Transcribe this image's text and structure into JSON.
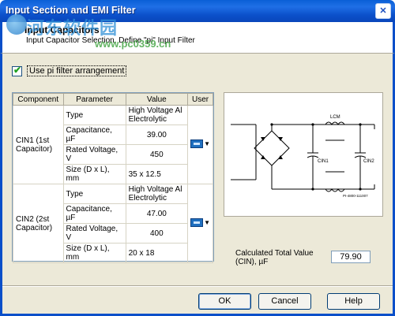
{
  "window": {
    "title": "Input Section and EMI Filter",
    "close_symbol": "✕"
  },
  "header": {
    "title": "Input Capacitors",
    "subtitle": "Input Capacitor Selection, Define \"pi\" Input Filter"
  },
  "watermark": {
    "text": "河东软件园",
    "url": "www.pc0359.cn"
  },
  "pi_filter": {
    "label": "Use pi filter arrangement",
    "checked": true
  },
  "table": {
    "columns": [
      "Component",
      "Parameter",
      "Value",
      "User"
    ],
    "components": [
      {
        "name": "CIN1 (1st Capacitor)",
        "rows": [
          {
            "parameter": "Type",
            "value": "High Voltage Al Electrolytic"
          },
          {
            "parameter": "Capacitance, µF",
            "value": "39.00"
          },
          {
            "parameter": "Rated Voltage, V",
            "value": "450"
          },
          {
            "parameter": "Size (D x L), mm",
            "value": "35 x 12.5"
          }
        ]
      },
      {
        "name": "CIN2 (2st Capacitor)",
        "rows": [
          {
            "parameter": "Type",
            "value": "High Voltage Al Electrolytic"
          },
          {
            "parameter": "Capacitance, µF",
            "value": "47.00"
          },
          {
            "parameter": "Rated Voltage, V",
            "value": "400"
          },
          {
            "parameter": "Size (D x L), mm",
            "value": "20 x 18"
          }
        ]
      }
    ]
  },
  "schematic": {
    "labels": {
      "cin1": "CIN1",
      "lcm": "LCM",
      "cin2": "CIN2",
      "ref": "PI-4800-111007"
    }
  },
  "calculated": {
    "label": "Calculated Total Value (CIN), µF",
    "value": "79.90"
  },
  "buttons": {
    "ok": "OK",
    "cancel": "Cancel",
    "help": "Help"
  }
}
